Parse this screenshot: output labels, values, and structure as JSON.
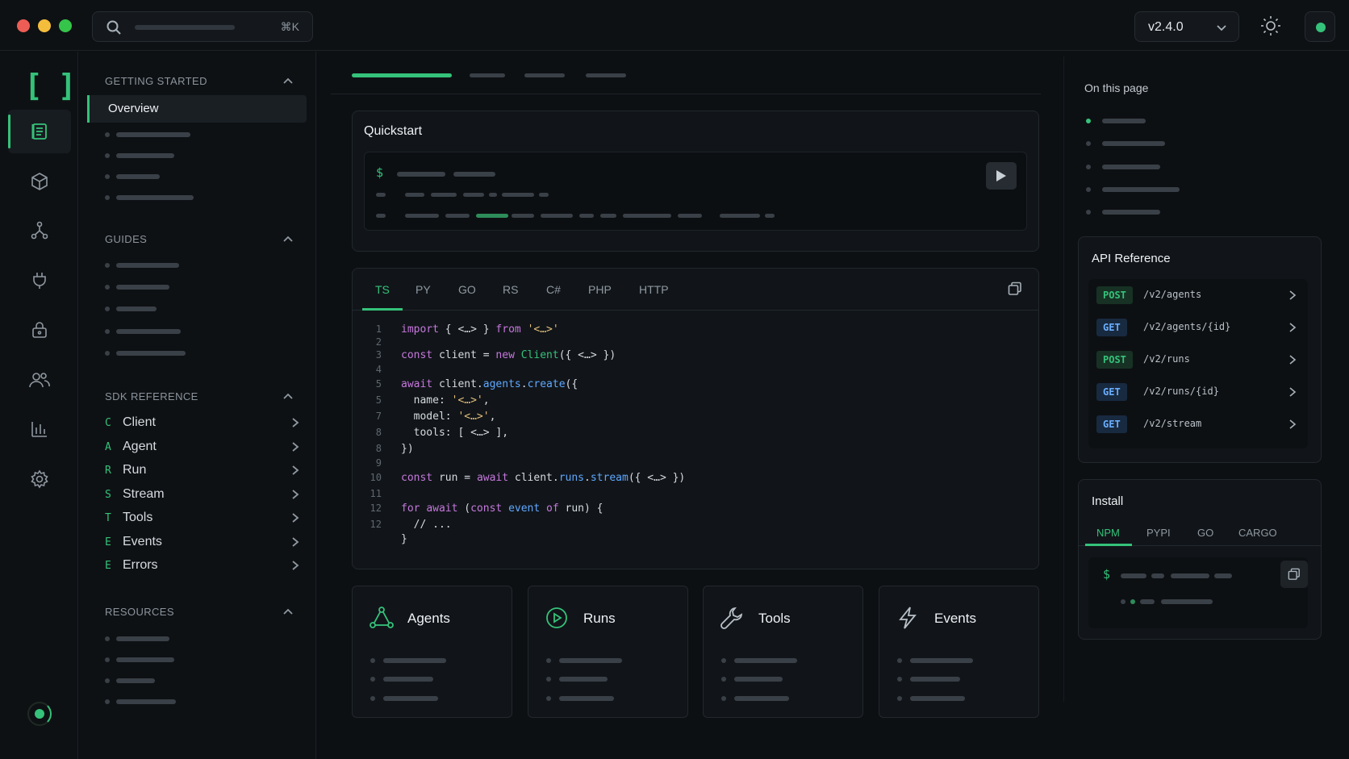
{
  "colors": {
    "accent": "#35c27a",
    "background": "#0d1013",
    "panel": "#111519",
    "post_badge": "#35c27a",
    "get_badge": "#6aaeff"
  },
  "window": {
    "traffic_lights": [
      "#ee5d55",
      "#f5bd3c",
      "#35c54a"
    ]
  },
  "topbar": {
    "search": {
      "icon": "search-icon",
      "shortcut": "⌘K"
    },
    "version": {
      "label": "v2.4.0",
      "icon": "chevron-down-icon"
    },
    "theme_icon": "sun-icon",
    "status": {
      "color": "#35c27a",
      "state": "online"
    }
  },
  "rail": {
    "logo": "[ ]",
    "items": [
      {
        "icon": "book-icon",
        "active": true
      },
      {
        "icon": "cube-icon",
        "active": false
      },
      {
        "icon": "git-graph-icon",
        "active": false
      },
      {
        "icon": "plug-icon",
        "active": false
      },
      {
        "icon": "lock-icon",
        "active": false
      },
      {
        "icon": "users-icon",
        "active": false
      },
      {
        "icon": "chart-icon",
        "active": false
      },
      {
        "icon": "gear-icon",
        "active": false
      }
    ]
  },
  "sidebar": {
    "getting_started": {
      "title": "GETTING STARTED",
      "active_item": "Overview"
    },
    "guides": {
      "title": "GUIDES"
    },
    "sdk_reference": {
      "title": "SDK REFERENCE",
      "items": [
        {
          "letter": "C",
          "label": "Client"
        },
        {
          "letter": "A",
          "label": "Agent"
        },
        {
          "letter": "R",
          "label": "Run"
        },
        {
          "letter": "S",
          "label": "Stream"
        },
        {
          "letter": "T",
          "label": "Tools"
        },
        {
          "letter": "E",
          "label": "Events"
        },
        {
          "letter": "E",
          "label": "Errors"
        }
      ]
    },
    "resources": {
      "title": "RESOURCES"
    }
  },
  "main": {
    "quickstart": {
      "title": "Quickstart",
      "prompt": "$",
      "run_icon": "play-icon"
    },
    "code_tabs": [
      "TS",
      "PY",
      "GO",
      "RS",
      "C#",
      "PHP",
      "HTTP"
    ],
    "active_code_tab": "TS",
    "copy_icon": "copy-icon",
    "line_numbers": [
      "1",
      "2",
      "3",
      "4",
      "5",
      "5",
      "7",
      "8",
      "8",
      "9",
      "10",
      "11",
      "12",
      "12"
    ],
    "code": {
      "l1": {
        "a": "import",
        "b": " { ",
        "c": "<…>",
        "d": " } ",
        "e": "from",
        "f": " ",
        "g": "'<…>'"
      },
      "l3": {
        "a": "const",
        "b": " client = ",
        "c": "new",
        "d": " ",
        "e": "Client",
        "f": "({ <…> })"
      },
      "l5": {
        "a": "await",
        "b": " client.",
        "c": "agents",
        "d": ".",
        "e": "create",
        "f": "({"
      },
      "l6": {
        "a": "  name: ",
        "b": "'<…>'",
        "c": ","
      },
      "l7": {
        "a": "  model: ",
        "b": "'<…>'",
        "c": ","
      },
      "l8": {
        "a": "  tools: [ <…> ],"
      },
      "l9": {
        "a": "})"
      },
      "l11": {
        "a": "const",
        "b": " run = ",
        "c": "await",
        "d": " client.",
        "e": "runs",
        "f": ".",
        "g": "stream",
        "h": "({ <…> })"
      },
      "l13": {
        "a": "for",
        "b": " ",
        "c": "await",
        "d": " (",
        "e": "const",
        "f": " ",
        "g": "event",
        "h": " ",
        "i": "of",
        "j": " run) {"
      },
      "l14": {
        "a": "  // ..."
      },
      "l15": {
        "a": "}"
      }
    },
    "cards": [
      {
        "icon": "agents-graph-icon",
        "title": "Agents"
      },
      {
        "icon": "play-circle-icon",
        "title": "Runs"
      },
      {
        "icon": "wrench-icon",
        "title": "Tools"
      },
      {
        "icon": "bolt-icon",
        "title": "Events"
      }
    ]
  },
  "right": {
    "on_this_page": {
      "title": "On this page"
    },
    "api_reference": {
      "title": "API Reference",
      "endpoints": [
        {
          "method": "POST",
          "path": "/v2/agents"
        },
        {
          "method": "GET",
          "path": "/v2/agents/{id}"
        },
        {
          "method": "POST",
          "path": "/v2/runs"
        },
        {
          "method": "GET",
          "path": "/v2/runs/{id}"
        },
        {
          "method": "GET",
          "path": "/v2/stream"
        }
      ]
    },
    "install": {
      "title": "Install",
      "tabs": [
        "NPM",
        "PYPI",
        "GO",
        "CARGO"
      ],
      "active_tab": "NPM",
      "prompt": "$"
    }
  }
}
